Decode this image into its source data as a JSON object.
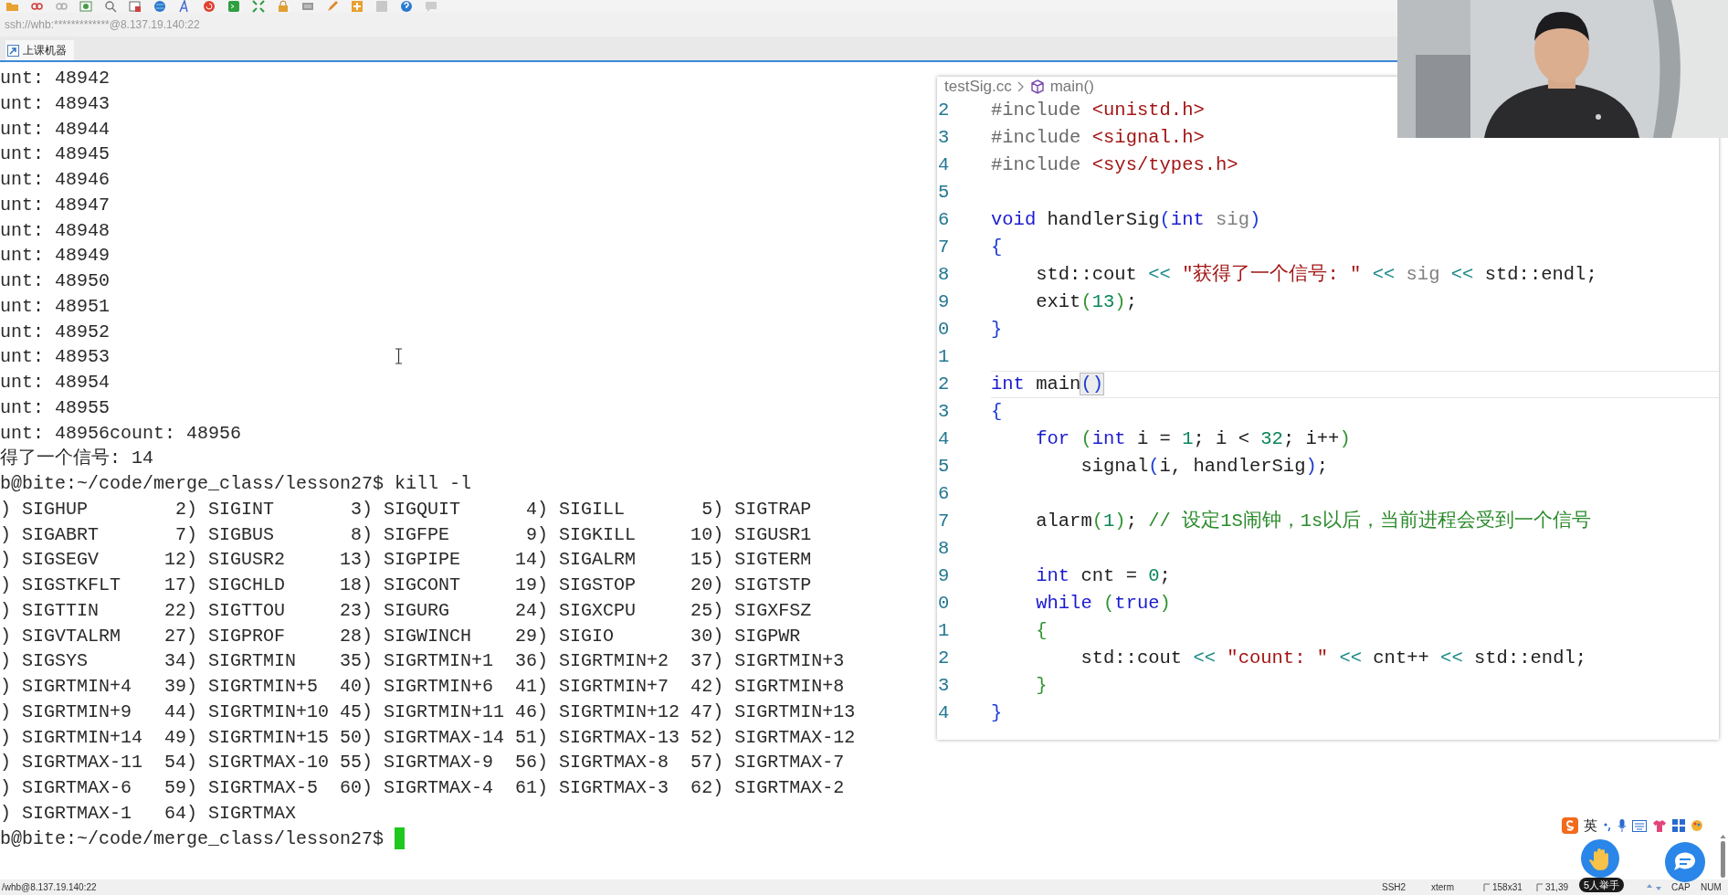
{
  "address_bar": {
    "text": "ssh://whb:*************@8.137.19.140:22"
  },
  "tabs": [
    {
      "label": "上课机器",
      "selected": true
    }
  ],
  "terminal": {
    "lines": [
      "unt: 48942",
      "unt: 48943",
      "unt: 48944",
      "unt: 48945",
      "unt: 48946",
      "unt: 48947",
      "unt: 48948",
      "unt: 48949",
      "unt: 48950",
      "unt: 48951",
      "unt: 48952",
      "unt: 48953",
      "unt: 48954",
      "unt: 48955",
      "unt: 48956count: 48956",
      "得了一个信号: 14",
      "b@bite:~/code/merge_class/lesson27$ kill -l",
      ") SIGHUP        2) SIGINT       3) SIGQUIT      4) SIGILL       5) SIGTRAP",
      ") SIGABRT       7) SIGBUS       8) SIGFPE       9) SIGKILL     10) SIGUSR1",
      ") SIGSEGV      12) SIGUSR2     13) SIGPIPE     14) SIGALRM     15) SIGTERM",
      ") SIGSTKFLT    17) SIGCHLD     18) SIGCONT     19) SIGSTOP     20) SIGTSTP",
      ") SIGTTIN      22) SIGTTOU     23) SIGURG      24) SIGXCPU     25) SIGXFSZ",
      ") SIGVTALRM    27) SIGPROF     28) SIGWINCH    29) SIGIO       30) SIGPWR",
      ") SIGSYS       34) SIGRTMIN    35) SIGRTMIN+1  36) SIGRTMIN+2  37) SIGRTMIN+3",
      ") SIGRTMIN+4   39) SIGRTMIN+5  40) SIGRTMIN+6  41) SIGRTMIN+7  42) SIGRTMIN+8",
      ") SIGRTMIN+9   44) SIGRTMIN+10 45) SIGRTMIN+11 46) SIGRTMIN+12 47) SIGRTMIN+13",
      ") SIGRTMIN+14  49) SIGRTMIN+15 50) SIGRTMAX-14 51) SIGRTMAX-13 52) SIGRTMAX-12",
      ") SIGRTMAX-11  54) SIGRTMAX-10 55) SIGRTMAX-9  56) SIGRTMAX-8  57) SIGRTMAX-7",
      ") SIGRTMAX-6   59) SIGRTMAX-5  60) SIGRTMAX-4  61) SIGRTMAX-3  62) SIGRTMAX-2",
      ") SIGRTMAX-1   64) SIGRTMAX"
    ],
    "prompt": "b@bite:~/code/merge_class/lesson27$ "
  },
  "editor": {
    "breadcrumb": [
      "testSig.cc",
      "main()"
    ],
    "lines": [
      {
        "number": "2",
        "current": false,
        "tokens": [
          {
            "kind": "pp",
            "text": "#include"
          },
          {
            "kind": "str",
            "text": " <unistd.h>"
          }
        ]
      },
      {
        "number": "3",
        "current": false,
        "tokens": [
          {
            "kind": "pp",
            "text": "#include"
          },
          {
            "kind": "str",
            "text": " <signal.h>"
          }
        ]
      },
      {
        "number": "4",
        "current": false,
        "tokens": [
          {
            "kind": "pp",
            "text": "#include"
          },
          {
            "kind": "str",
            "text": " <sys/types.h>"
          }
        ]
      },
      {
        "number": "5",
        "current": false
      },
      {
        "number": "6",
        "current": false,
        "tokens": [
          {
            "kind": "kw",
            "text": "void"
          },
          {
            "kind": "pl",
            "text": " handlerSig"
          },
          {
            "kind": "b1",
            "text": "("
          },
          {
            "kind": "kw",
            "text": "int"
          },
          {
            "kind": "pa",
            "text": " sig"
          },
          {
            "kind": "b1",
            "text": ")"
          }
        ]
      },
      {
        "number": "7",
        "current": false,
        "tokens": [
          {
            "kind": "b1",
            "text": "{"
          }
        ]
      },
      {
        "number": "8",
        "current": false,
        "tokens": [
          {
            "kind": "pl",
            "text": "    std::cout "
          },
          {
            "kind": "op",
            "text": "<<"
          },
          {
            "kind": "str",
            "text": " \"获得了一个信号: \""
          },
          {
            "kind": "op",
            "text": " <<"
          },
          {
            "kind": "pa",
            "text": " sig"
          },
          {
            "kind": "op",
            "text": " <<"
          },
          {
            "kind": "pl",
            "text": " std::endl;"
          }
        ]
      },
      {
        "number": "9",
        "current": false,
        "tokens": [
          {
            "kind": "pl",
            "text": "    exit"
          },
          {
            "kind": "b2",
            "text": "("
          },
          {
            "kind": "num",
            "text": "13"
          },
          {
            "kind": "b2",
            "text": ")"
          },
          {
            "kind": "pl",
            "text": ";"
          }
        ]
      },
      {
        "number": "0",
        "current": false,
        "tokens": [
          {
            "kind": "b1",
            "text": "}"
          }
        ]
      },
      {
        "number": "1",
        "current": false
      },
      {
        "number": "2",
        "current": true,
        "tokens": [
          {
            "kind": "kw",
            "text": "int"
          },
          {
            "kind": "pl",
            "text": " main"
          },
          {
            "kind": "match",
            "text": "()"
          }
        ]
      },
      {
        "number": "3",
        "current": false,
        "tokens": [
          {
            "kind": "b1",
            "text": "{"
          }
        ]
      },
      {
        "number": "4",
        "current": false,
        "tokens": [
          {
            "kind": "kw",
            "text": "    for"
          },
          {
            "kind": "b2",
            "text": " ("
          },
          {
            "kind": "kw",
            "text": "int"
          },
          {
            "kind": "pl",
            "text": " i = "
          },
          {
            "kind": "num",
            "text": "1"
          },
          {
            "kind": "pl",
            "text": "; i < "
          },
          {
            "kind": "num",
            "text": "32"
          },
          {
            "kind": "pl",
            "text": "; i++"
          },
          {
            "kind": "b2",
            "text": ")"
          }
        ]
      },
      {
        "number": "5",
        "current": false,
        "tokens": [
          {
            "kind": "pl",
            "text": "        signal"
          },
          {
            "kind": "b1",
            "text": "("
          },
          {
            "kind": "pl",
            "text": "i, handlerSig"
          },
          {
            "kind": "b1",
            "text": ")"
          },
          {
            "kind": "pl",
            "text": ";"
          }
        ]
      },
      {
        "number": "6",
        "current": false
      },
      {
        "number": "7",
        "current": false,
        "tokens": [
          {
            "kind": "pl",
            "text": "    alarm"
          },
          {
            "kind": "b2",
            "text": "("
          },
          {
            "kind": "num",
            "text": "1"
          },
          {
            "kind": "b2",
            "text": ")"
          },
          {
            "kind": "pl",
            "text": ";"
          },
          {
            "kind": "cm",
            "text": " // 设定1S闹钟，1s以后，当前进程会受到一个信号"
          }
        ]
      },
      {
        "number": "8",
        "current": false
      },
      {
        "number": "9",
        "current": false,
        "tokens": [
          {
            "kind": "kw",
            "text": "    int"
          },
          {
            "kind": "pl",
            "text": " cnt = "
          },
          {
            "kind": "num",
            "text": "0"
          },
          {
            "kind": "pl",
            "text": ";"
          }
        ]
      },
      {
        "number": "0",
        "current": false,
        "tokens": [
          {
            "kind": "kw",
            "text": "    while"
          },
          {
            "kind": "b2",
            "text": " ("
          },
          {
            "kind": "kw",
            "text": "true"
          },
          {
            "kind": "b2",
            "text": ")"
          }
        ]
      },
      {
        "number": "1",
        "current": false,
        "tokens": [
          {
            "kind": "b2",
            "text": "    {"
          }
        ]
      },
      {
        "number": "2",
        "current": false,
        "tokens": [
          {
            "kind": "pl",
            "text": "        std::cout "
          },
          {
            "kind": "op",
            "text": "<<"
          },
          {
            "kind": "str",
            "text": " \"count: \""
          },
          {
            "kind": "op",
            "text": " <<"
          },
          {
            "kind": "pl",
            "text": " cnt++ "
          },
          {
            "kind": "op",
            "text": "<<"
          },
          {
            "kind": "pl",
            "text": " std::endl;"
          }
        ]
      },
      {
        "number": "3",
        "current": false,
        "tokens": [
          {
            "kind": "b2",
            "text": "    }"
          }
        ]
      },
      {
        "number": "4",
        "current": false,
        "tokens": [
          {
            "kind": "b1",
            "text": "}"
          }
        ]
      }
    ]
  },
  "ime": {
    "mode": "英"
  },
  "hand_raise": {
    "badge": "5人举手"
  },
  "status_bar": {
    "host": "/whb@8.137.19.140:22",
    "items": [
      "SSH2",
      "xterm",
      "158x31",
      "31,39",
      "CAP",
      "NUM"
    ]
  }
}
